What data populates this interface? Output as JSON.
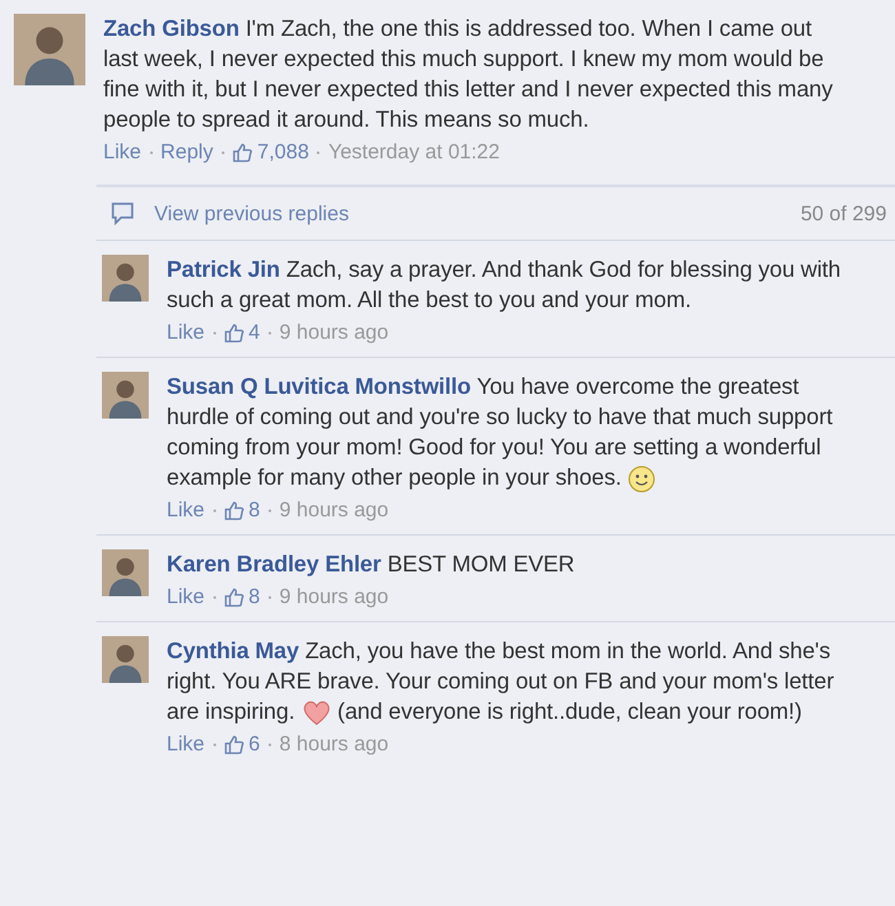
{
  "comment": {
    "author": "Zach Gibson",
    "body": [
      {
        "kind": "text",
        "text": "I'm Zach, the one this is addressed too. When I came out last week, I never expected this much support. I knew my mom would be fine with it, but I never expected this letter and I never expected this many people to spread it around. This means so much."
      }
    ],
    "like": "Like",
    "reply": "Reply",
    "likes": "7,088",
    "time": "Yesterday at 01:22"
  },
  "replies": {
    "view_previous": "View previous replies",
    "count": "50 of 299",
    "items": [
      {
        "author": "Patrick Jin",
        "body": [
          {
            "kind": "text",
            "text": "Zach, say a prayer. And thank God for blessing you with such a great mom. All the best to you and your mom."
          }
        ],
        "like": "Like",
        "likes": "4",
        "time": "9 hours ago"
      },
      {
        "author": "Susan Q Luvitica Monstwillo",
        "body": [
          {
            "kind": "text",
            "text": "You have overcome the greatest hurdle of coming out and you're so lucky to have that much support coming from your mom! Good for you! You are setting a wonderful example for many other people in your shoes. "
          },
          {
            "kind": "smiley"
          }
        ],
        "like": "Like",
        "likes": "8",
        "time": "9 hours ago"
      },
      {
        "author": "Karen Bradley Ehler",
        "body": [
          {
            "kind": "text",
            "text": "BEST MOM EVER"
          }
        ],
        "like": "Like",
        "likes": "8",
        "time": "9 hours ago"
      },
      {
        "author": "Cynthia May",
        "body": [
          {
            "kind": "text",
            "text": "Zach, you have the best mom in the world. And she's right. You ARE brave. Your coming out on FB and your mom's letter are inspiring. "
          },
          {
            "kind": "heart"
          },
          {
            "kind": "text",
            "text": " (and everyone is right..dude, clean your room!)"
          }
        ],
        "like": "Like",
        "likes": "6",
        "time": "8 hours ago"
      }
    ]
  }
}
